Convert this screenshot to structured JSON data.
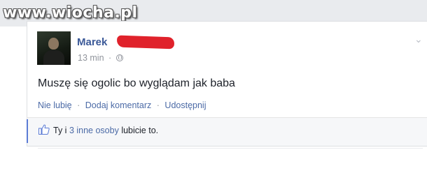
{
  "watermark": "www.wiocha.pl",
  "post": {
    "author": "Marek",
    "time": "13 min",
    "separator": "·",
    "text": "Muszę się ogolic bo wyglądam jak baba"
  },
  "actions": {
    "unlike": "Nie lubię",
    "comment": "Dodaj komentarz",
    "share": "Udostępnij",
    "dot": "·"
  },
  "likes": {
    "prefix": "Ty i",
    "others_link": "3 inne osoby",
    "suffix": "lubicie to."
  },
  "icons": {
    "privacy": "globe-icon",
    "like": "thumbs-up-icon",
    "close": "close-icon"
  },
  "colors": {
    "link": "#3b5998",
    "redaction": "#e0222b"
  }
}
